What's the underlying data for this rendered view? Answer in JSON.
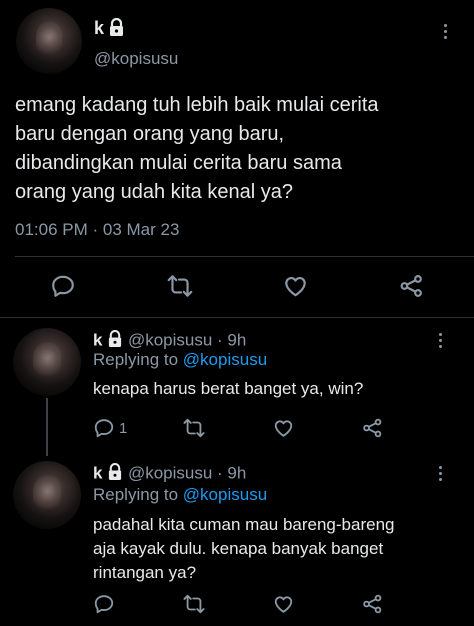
{
  "main_tweet": {
    "display_name": "k",
    "handle": "@kopisusu",
    "text_lines": [
      "emang kadang tuh lebih baik mulai cerita",
      "baru dengan orang yang baru,",
      "dibandingkan mulai cerita baru sama",
      "orang yang udah kita kenal ya?"
    ],
    "timestamp": "01:06 PM · 03 Mar 23",
    "actions": [
      "reply-icon",
      "retweet-icon",
      "like-icon",
      "share-icon"
    ]
  },
  "replies": [
    {
      "display_name": "k",
      "handle_time": "@kopisusu · 9h",
      "replying_prefix": "Replying to",
      "replying_handle": "@kopisusu",
      "text_lines": [
        "kenapa harus berat banget ya, win?"
      ],
      "reply_count": "1"
    },
    {
      "display_name": "k",
      "handle_time": "@kopisusu · 9h",
      "replying_prefix": "Replying to",
      "replying_handle": "@kopisusu",
      "text_lines": [
        "padahal kita cuman mau bareng-bareng",
        "aja kayak dulu. kenapa banyak banget",
        "rintangan ya?"
      ],
      "reply_count": ""
    }
  ],
  "colors": {
    "background": "#000000",
    "text": "#e7e9ea",
    "muted": "#8b98a5",
    "link": "#1d9bf0",
    "divider": "#2f3336"
  }
}
